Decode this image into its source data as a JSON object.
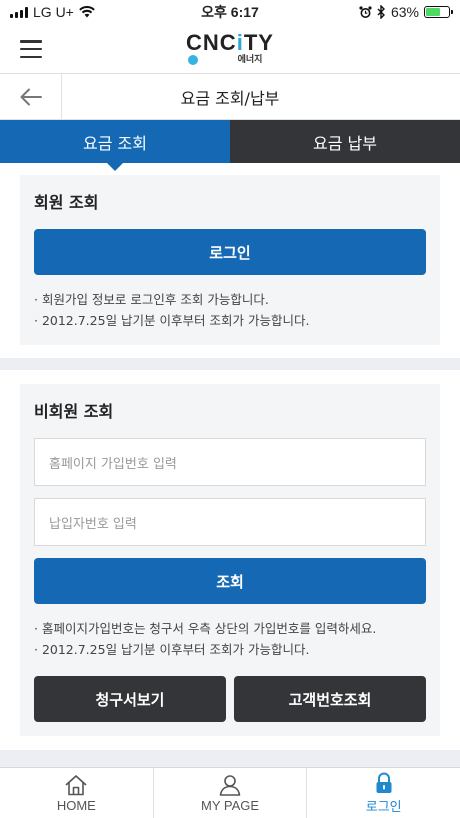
{
  "status_bar": {
    "carrier": "LG U+",
    "time": "오후 6:17",
    "battery": "63%"
  },
  "app": {
    "logo_main": "CNCITY",
    "logo_main_prefix": "CNC",
    "logo_main_i": "i",
    "logo_main_suffix": "TY",
    "logo_sub": "에너지"
  },
  "title_bar": {
    "title": "요금 조회/납부"
  },
  "tabs": [
    {
      "label": "요금 조회",
      "active": true
    },
    {
      "label": "요금 납부",
      "active": false
    }
  ],
  "member_section": {
    "title": "회원 조회",
    "login_button": "로그인",
    "notes": [
      "· 회원가입 정보로 로그인후 조회 가능합니다.",
      "· 2012.7.25일 납기분 이후부터 조회가 가능합니다."
    ]
  },
  "guest_section": {
    "title": "비회원 조회",
    "homepage_id_placeholder": "홈페이지 가입번호 입력",
    "payer_no_placeholder": "납입자번호 입력",
    "search_button": "조회",
    "notes": [
      "· 홈페이지가입번호는 청구서 우측 상단의 가입번호를 입력하세요.",
      "· 2012.7.25일 납기분 이후부터 조회가 가능합니다."
    ],
    "bill_button": "청구서보기",
    "customer_no_button": "고객번호조회"
  },
  "bottom_nav": [
    {
      "label": "HOME",
      "icon": "home-icon",
      "active": false
    },
    {
      "label": "MY PAGE",
      "icon": "user-icon",
      "active": false
    },
    {
      "label": "로그인",
      "icon": "lock-icon",
      "active": true
    }
  ],
  "colors": {
    "primary": "#1569b4",
    "dark": "#333538",
    "active_nav": "#1e88d0"
  }
}
